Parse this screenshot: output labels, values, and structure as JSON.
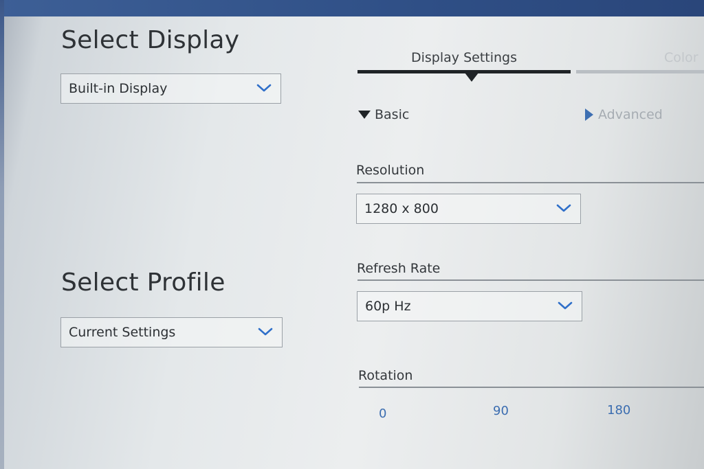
{
  "left": {
    "select_display": {
      "title": "Select Display",
      "value": "Built-in Display"
    },
    "select_profile": {
      "title": "Select Profile",
      "value": "Current Settings"
    }
  },
  "tabs": [
    {
      "label": "Display Settings",
      "active": true
    },
    {
      "label": "Color",
      "active": false
    }
  ],
  "modes": {
    "basic": "Basic",
    "advanced": "Advanced"
  },
  "settings": {
    "resolution": {
      "label": "Resolution",
      "value": "1280 x 800"
    },
    "refresh_rate": {
      "label": "Refresh Rate",
      "value": "60p Hz"
    },
    "rotation": {
      "label": "Rotation",
      "options": [
        "0",
        "90",
        "180"
      ]
    }
  },
  "colors": {
    "accent": "#2f6fc9",
    "tab_active": "#1f2326",
    "tab_inactive": "#b9bec3",
    "link": "#3b6db0"
  },
  "icons": {
    "dropdown": "chevron-down-icon",
    "expanded": "triangle-down-icon",
    "collapsed": "triangle-right-icon"
  }
}
